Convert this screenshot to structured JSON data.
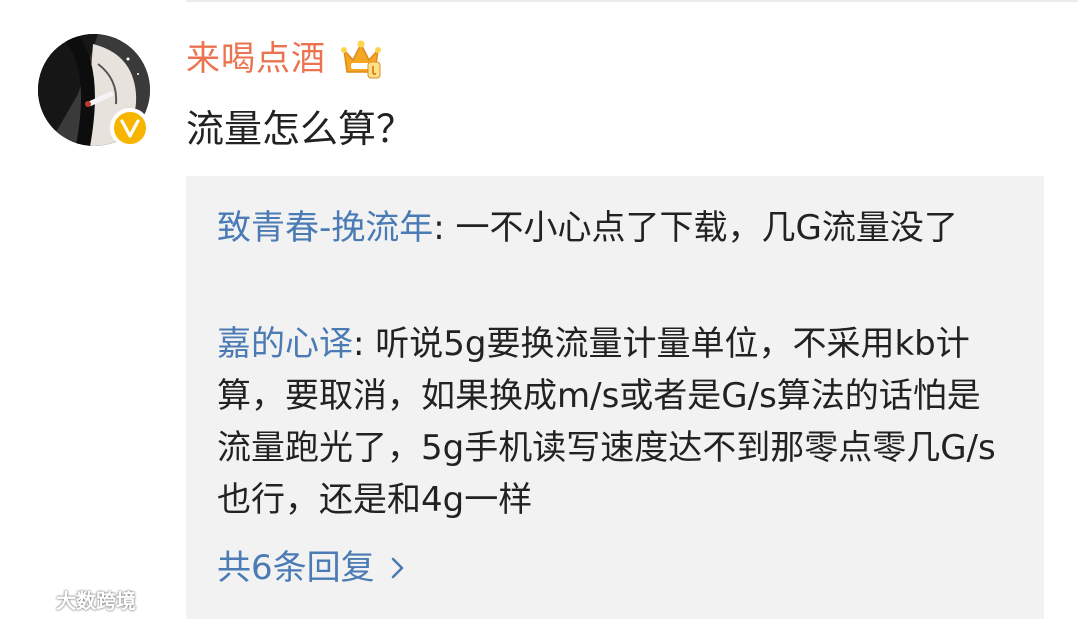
{
  "comment": {
    "username": "来喝点酒",
    "text": "流量怎么算？",
    "icons": {
      "avatar": "avatar-anime-figure",
      "verified_badge": "verified-v-badge",
      "member_crown": "crown-badge-icon"
    },
    "colors": {
      "username": "#eb7350",
      "link": "#4a7bb4",
      "reply_bg": "#f2f2f2",
      "verified": "#f7b500"
    }
  },
  "replies": [
    {
      "author": "致青春-挽流年",
      "separator": ": ",
      "text": "一不小心点了下载，几G流量没了"
    },
    {
      "author": "嘉的心译",
      "separator": ": ",
      "text": "听说5g要换流量计量单位，不采用kb计算，要取消，如果换成m/s或者是G/s算法的话怕是流量跑光了，5g手机读写速度达不到那零点零几G/s也行，还是和4g一样"
    }
  ],
  "more_replies": {
    "label": "共6条回复",
    "icon": "chevron-right-icon"
  },
  "watermark": {
    "text": "大数跨境"
  }
}
